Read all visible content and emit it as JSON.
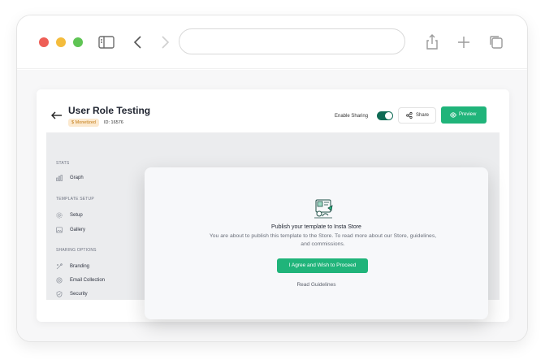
{
  "page": {
    "title": "User Role Testing",
    "badge": "$ Monetized",
    "id_text": "ID: 16576",
    "enable_sharing_label": "Enable Sharing",
    "enable_sharing_on": true,
    "share_label": "Share",
    "preview_label": "Preview"
  },
  "sidebar": {
    "sections": [
      {
        "title": "STATS",
        "items": [
          {
            "label": "Graph",
            "icon": "graph-icon"
          }
        ]
      },
      {
        "title": "TEMPLATE SETUP",
        "items": [
          {
            "label": "Setup",
            "icon": "gear-icon"
          },
          {
            "label": "Gallery",
            "icon": "image-icon"
          }
        ]
      },
      {
        "title": "SHARING OPTIONS",
        "items": [
          {
            "label": "Branding",
            "icon": "branding-icon"
          },
          {
            "label": "Email Collection",
            "icon": "email-icon"
          },
          {
            "label": "Security",
            "icon": "shield-icon"
          }
        ]
      }
    ]
  },
  "modal": {
    "title": "Publish your template to Insta Store",
    "description": "You are about to publish this template to the Store. To read more about our Store, guidelines, and commissions.",
    "primary_button": "I Agree and Wish to Proceed",
    "secondary_link": "Read Guidelines",
    "illustration_icon": "store-illustration-icon"
  },
  "colors": {
    "accent_green": "#20b47a",
    "toggle_dark_green": "#0f6b55",
    "badge_bg": "#fce9cf",
    "badge_text": "#c27c17"
  }
}
